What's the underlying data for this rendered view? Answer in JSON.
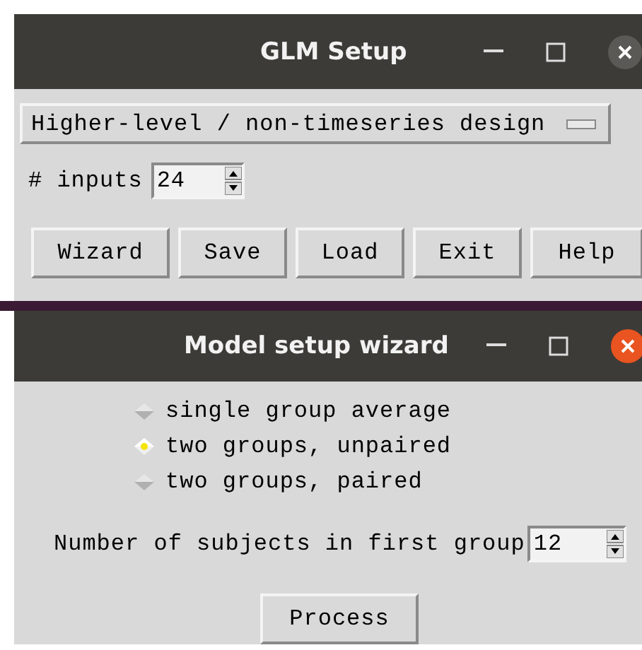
{
  "glm_setup": {
    "title": "GLM Setup",
    "active": false,
    "design_menu": {
      "value": "Higher-level / non-timeseries design"
    },
    "inputs": {
      "label": "# inputs",
      "value": "24"
    },
    "buttons": [
      "Wizard",
      "Save",
      "Load",
      "Exit",
      "Help"
    ]
  },
  "model_setup_wizard": {
    "title": "Model setup wizard",
    "active": true,
    "options": [
      {
        "label": "single group average",
        "selected": false
      },
      {
        "label": "two groups, unpaired",
        "selected": true
      },
      {
        "label": "two groups, paired",
        "selected": false
      }
    ],
    "subjects": {
      "label": "Number of subjects in first group",
      "value": "12"
    },
    "button": "Process"
  }
}
